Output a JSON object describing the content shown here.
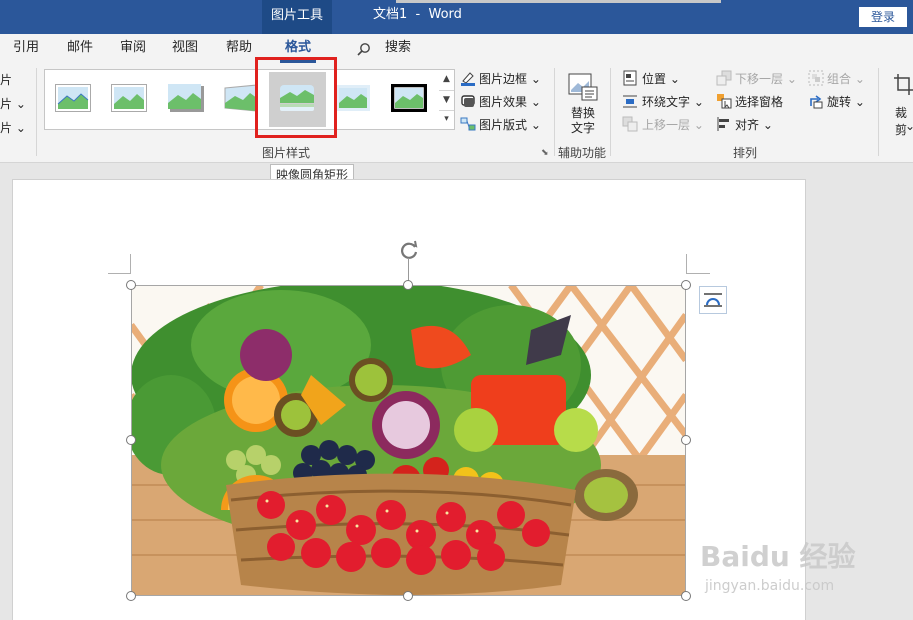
{
  "titlebar": {
    "context_tab": "图片工具",
    "doc_title": "文档1  -  Word",
    "login": "登录"
  },
  "tabs": [
    "引用",
    "邮件",
    "审阅",
    "视图",
    "帮助",
    "格式"
  ],
  "active_tab": "格式",
  "search_label": "搜索",
  "ribbon": {
    "left_partial": [
      "片",
      "片 ⌄",
      "片 ⌄"
    ],
    "picture_styles": {
      "group_label": "图片样式",
      "border": "图片边框 ⌄",
      "effects": "图片效果 ⌄",
      "layout": "图片版式 ⌄"
    },
    "accessibility": {
      "alt_text_line1": "替换",
      "alt_text_line2": "文字",
      "group_label": "辅助功能"
    },
    "arrange": {
      "group_label": "排列",
      "position": "位置 ⌄",
      "wrap_text": "环绕文字 ⌄",
      "bring_forward": "上移一层 ⌄",
      "send_backward": "下移一层 ⌄",
      "selection_pane": "选择窗格",
      "align": "对齐 ⌄",
      "group": "组合 ⌄",
      "rotate": "旋转 ⌄"
    },
    "crop_partial": "裁剪"
  },
  "tooltip": "映像圆角矩形",
  "watermark": {
    "main": "Baidu 经验",
    "sub": "jingyan.baidu.com"
  },
  "colors": {
    "titlebar": "#2b579a",
    "highlight": "#e0211e",
    "ribbon": "#f3f3f3"
  }
}
